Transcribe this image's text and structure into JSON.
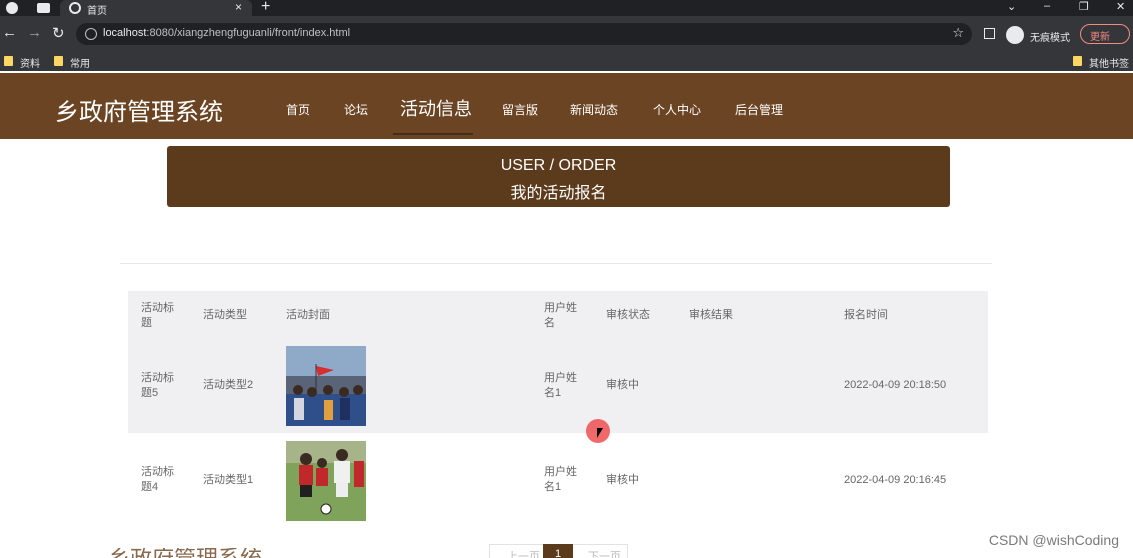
{
  "browser": {
    "tab_title": "首页",
    "new_tab": "+",
    "url_host": "localhost",
    "url_rest": ":8080/xiangzhengfuguanli/front/index.html",
    "incognito_label": "无痕模式",
    "update_label": "更新",
    "bookmarks": [
      "资料",
      "常用"
    ],
    "other_bookmarks": "其他书签"
  },
  "site": {
    "logo": "乡政府管理系统",
    "nav": [
      "首页",
      "论坛",
      "活动信息",
      "留言版",
      "新闻动态",
      "个人中心",
      "后台管理"
    ],
    "active_nav": "活动信息"
  },
  "banner": {
    "title_en": "USER / ORDER",
    "title_cn": "我的活动报名"
  },
  "table": {
    "headers": [
      "活动标题",
      "活动类型",
      "活动封面",
      "用户姓名",
      "审核状态",
      "审核结果",
      "报名时间"
    ],
    "rows": [
      {
        "title": "活动标题5",
        "type": "活动类型2",
        "cover": "photo-flag-crowd",
        "user": "用户姓名1",
        "status": "审核中",
        "result": "",
        "time": "2022-04-09 20:18:50"
      },
      {
        "title": "活动标题4",
        "type": "活动类型1",
        "cover": "photo-football-kids",
        "user": "用户姓名1",
        "status": "审核中",
        "result": "",
        "time": "2022-04-09 20:16:45"
      }
    ]
  },
  "pagination": {
    "prev": "上一页",
    "current": "1",
    "next": "下一页"
  },
  "footer_peek": "乡政府管理系统",
  "watermark": "CSDN @wishCoding",
  "colors": {
    "header_bg": "#6b4423",
    "banner_bg": "#5c3a1c",
    "row_alt": "#f0f0f3"
  }
}
